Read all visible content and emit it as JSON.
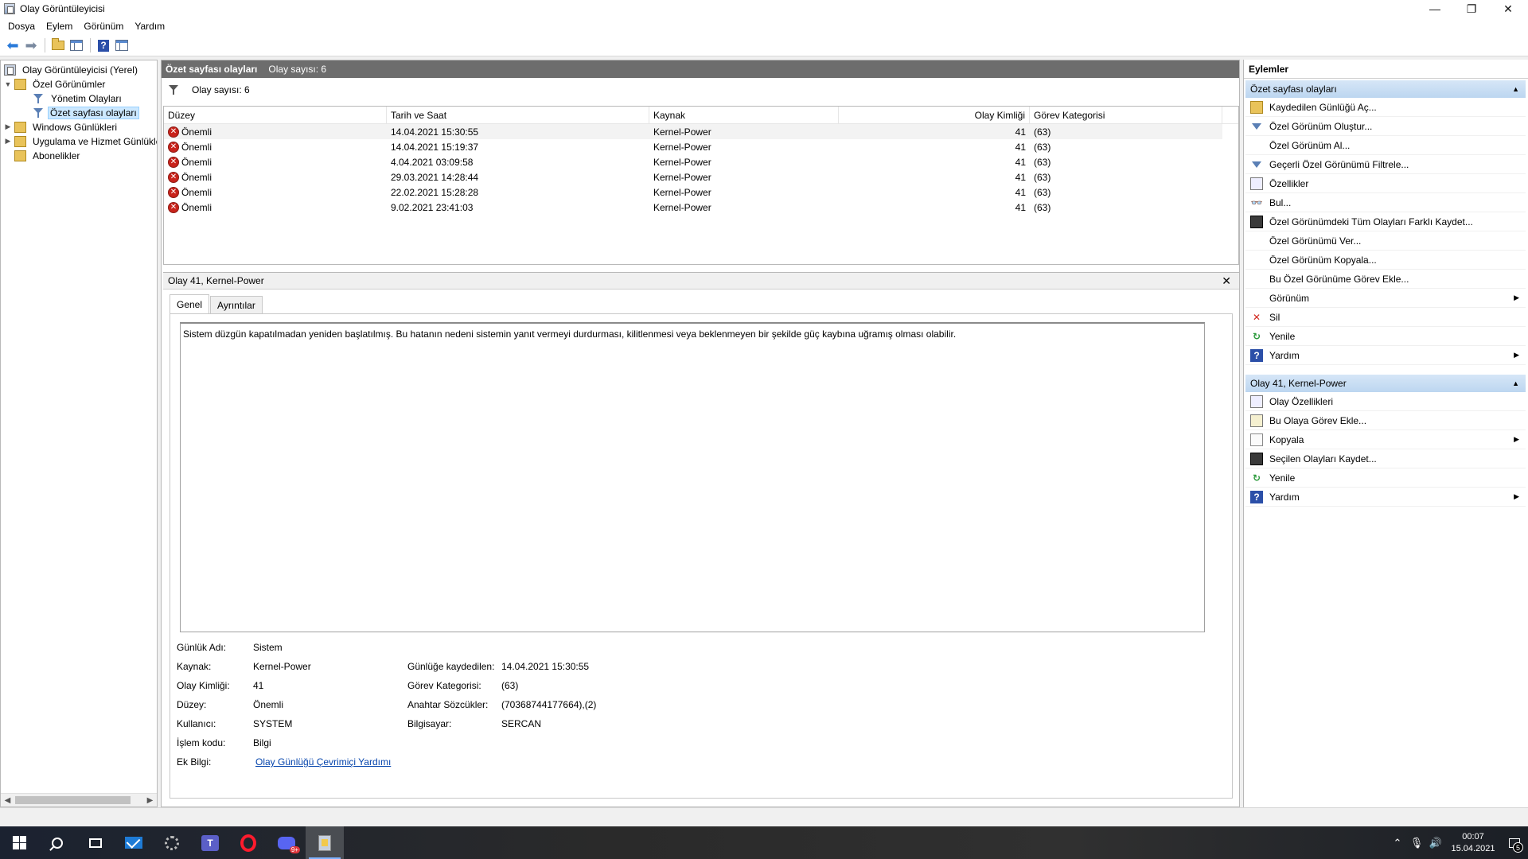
{
  "window": {
    "title": "Olay Görüntüleyicisi",
    "minimize": "—",
    "restore": "❐",
    "close": "✕"
  },
  "menu": [
    "Dosya",
    "Eylem",
    "Görünüm",
    "Yardım"
  ],
  "tree": {
    "root": "Olay Görüntüleyicisi (Yerel)",
    "custom_views": "Özel Görünümler",
    "admin_events": "Yönetim Olayları",
    "summary_events": "Özet sayfası olayları",
    "windows_logs": "Windows Günlükleri",
    "app_logs": "Uygulama ve Hizmet Günlükleri",
    "subscriptions": "Abonelikler"
  },
  "center": {
    "header_title": "Özet sayfası olayları",
    "header_count": "Olay sayısı: 6",
    "filter_text": "Olay sayısı: 6",
    "columns": [
      "Düzey",
      "Tarih ve Saat",
      "Kaynak",
      "Olay Kimliği",
      "Görev Kategorisi"
    ],
    "rows": [
      {
        "level": "Önemli",
        "datetime": "14.04.2021 15:30:55",
        "source": "Kernel-Power",
        "id": "41",
        "category": "(63)"
      },
      {
        "level": "Önemli",
        "datetime": "14.04.2021 15:19:37",
        "source": "Kernel-Power",
        "id": "41",
        "category": "(63)"
      },
      {
        "level": "Önemli",
        "datetime": "4.04.2021 03:09:58",
        "source": "Kernel-Power",
        "id": "41",
        "category": "(63)"
      },
      {
        "level": "Önemli",
        "datetime": "29.03.2021 14:28:44",
        "source": "Kernel-Power",
        "id": "41",
        "category": "(63)"
      },
      {
        "level": "Önemli",
        "datetime": "22.02.2021 15:28:28",
        "source": "Kernel-Power",
        "id": "41",
        "category": "(63)"
      },
      {
        "level": "Önemli",
        "datetime": "9.02.2021 23:41:03",
        "source": "Kernel-Power",
        "id": "41",
        "category": "(63)"
      }
    ]
  },
  "detail": {
    "title": "Olay 41, Kernel-Power",
    "close": "✕",
    "tab_general": "Genel",
    "tab_details": "Ayrıntılar",
    "description": "Sistem düzgün kapatılmadan yeniden başlatılmış. Bu hatanın nedeni sistemin yanıt vermeyi durdurması, kilitlenmesi veya beklenmeyen bir şekilde güç kaybına uğramış olması olabilir.",
    "props": {
      "log_name_label": "Günlük Adı:",
      "log_name": "Sistem",
      "source_label": "Kaynak:",
      "source": "Kernel-Power",
      "logged_label": "Günlüğe kaydedilen:",
      "logged": "14.04.2021 15:30:55",
      "event_id_label": "Olay Kimliği:",
      "event_id": "41",
      "task_label": "Görev Kategorisi:",
      "task": "(63)",
      "level_label": "Düzey:",
      "level": "Önemli",
      "keywords_label": "Anahtar Sözcükler:",
      "keywords": "(70368744177664),(2)",
      "user_label": "Kullanıcı:",
      "user": "SYSTEM",
      "computer_label": "Bilgisayar:",
      "computer": "SERCAN",
      "opcode_label": "İşlem kodu:",
      "opcode": "Bilgi",
      "more_label": "Ek Bilgi:",
      "more_link": "Olay Günlüğü Çevrimiçi Yardımı"
    }
  },
  "actions": {
    "title": "Eylemler",
    "section1": "Özet sayfası olayları",
    "items1": [
      "Kaydedilen Günlüğü Aç...",
      "Özel Görünüm Oluştur...",
      "Özel Görünüm Al...",
      "Geçerli Özel Görünümü Filtrele...",
      "Özellikler",
      "Bul...",
      "Özel Görünümdeki Tüm Olayları Farklı Kaydet...",
      "Özel Görünümü Ver...",
      "Özel Görünüm Kopyala...",
      "Bu Özel Görünüme Görev Ekle...",
      "Görünüm",
      "Sil",
      "Yenile",
      "Yardım"
    ],
    "section2": "Olay 41, Kernel-Power",
    "items2": [
      "Olay Özellikleri",
      "Bu Olaya Görev Ekle...",
      "Kopyala",
      "Seçilen Olayları Kaydet...",
      "Yenile",
      "Yardım"
    ]
  },
  "taskbar": {
    "time": "00:07",
    "date": "15.04.2021",
    "notification_count": "5",
    "discord_badge": "9+"
  }
}
